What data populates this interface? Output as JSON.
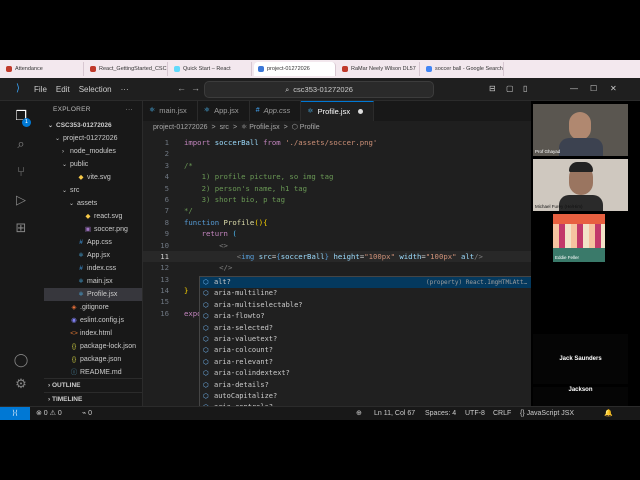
{
  "browser_tabs": [
    {
      "label": "Attendance",
      "color": "#c0392b",
      "active": false
    },
    {
      "label": "React_GettingStarted_CSC",
      "color": "#c0392b",
      "active": false
    },
    {
      "label": "Quick Start – React",
      "color": "#61dafb",
      "active": false
    },
    {
      "label": "project-01272026",
      "color": "#3c78d8",
      "active": true
    },
    {
      "label": "RaMar Neely Wilson DL57",
      "color": "#c0392b",
      "active": false
    },
    {
      "label": "soccer ball - Google Search",
      "color": "#4285f4",
      "active": false
    }
  ],
  "titlebar": {
    "menus": [
      "File",
      "Edit",
      "Selection",
      "···"
    ],
    "search_text": "csc353-01272026",
    "window_controls": [
      "⊟",
      "▢",
      "▯",
      "—",
      "☐",
      "✕"
    ]
  },
  "explorer": {
    "header": "EXPLORER",
    "dots": "···",
    "items": [
      {
        "label": "CSC353-01272026",
        "depth": 0,
        "twisty": "⌄",
        "icon": "",
        "bold": true,
        "selected": false
      },
      {
        "label": "project-01272026",
        "depth": 1,
        "twisty": "⌄",
        "icon": "",
        "bold": false,
        "selected": false
      },
      {
        "label": "node_modules",
        "depth": 2,
        "twisty": "›",
        "icon": "",
        "bold": false,
        "selected": false
      },
      {
        "label": "public",
        "depth": 2,
        "twisty": "⌄",
        "icon": "",
        "bold": false,
        "selected": false
      },
      {
        "label": "vite.svg",
        "depth": 3,
        "twisty": "",
        "icon": "◆",
        "iconColor": "#f7c948",
        "bold": false,
        "selected": false
      },
      {
        "label": "src",
        "depth": 2,
        "twisty": "⌄",
        "icon": "",
        "bold": false,
        "selected": false
      },
      {
        "label": "assets",
        "depth": 3,
        "twisty": "⌄",
        "icon": "",
        "bold": false,
        "selected": false
      },
      {
        "label": "react.svg",
        "depth": 4,
        "twisty": "",
        "icon": "◆",
        "iconColor": "#f7c948",
        "bold": false,
        "selected": false
      },
      {
        "label": "soccer.png",
        "depth": 4,
        "twisty": "",
        "icon": "▣",
        "iconColor": "#a074c4",
        "bold": false,
        "selected": false
      },
      {
        "label": "App.css",
        "depth": 3,
        "twisty": "",
        "icon": "#",
        "iconColor": "#42a5f5",
        "bold": false,
        "selected": false
      },
      {
        "label": "App.jsx",
        "depth": 3,
        "twisty": "",
        "icon": "⚛",
        "iconColor": "#4fc1ff",
        "bold": false,
        "selected": false
      },
      {
        "label": "index.css",
        "depth": 3,
        "twisty": "",
        "icon": "#",
        "iconColor": "#42a5f5",
        "bold": false,
        "selected": false
      },
      {
        "label": "main.jsx",
        "depth": 3,
        "twisty": "",
        "icon": "⚛",
        "iconColor": "#4fc1ff",
        "bold": false,
        "selected": false
      },
      {
        "label": "Profile.jsx",
        "depth": 3,
        "twisty": "",
        "icon": "⚛",
        "iconColor": "#4fc1ff",
        "bold": false,
        "selected": true
      },
      {
        "label": ".gitignore",
        "depth": 2,
        "twisty": "",
        "icon": "◈",
        "iconColor": "#e8703a",
        "bold": false,
        "selected": false
      },
      {
        "label": "eslint.config.js",
        "depth": 2,
        "twisty": "",
        "icon": "◉",
        "iconColor": "#8080f2",
        "bold": false,
        "selected": false
      },
      {
        "label": "index.html",
        "depth": 2,
        "twisty": "",
        "icon": "<>",
        "iconColor": "#e37933",
        "bold": false,
        "selected": false
      },
      {
        "label": "package-lock.json",
        "depth": 2,
        "twisty": "",
        "icon": "{}",
        "iconColor": "#cbcb41",
        "bold": false,
        "selected": false
      },
      {
        "label": "package.json",
        "depth": 2,
        "twisty": "",
        "icon": "{}",
        "iconColor": "#cbcb41",
        "bold": false,
        "selected": false
      },
      {
        "label": "README.md",
        "depth": 2,
        "twisty": "",
        "icon": "ⓘ",
        "iconColor": "#519aba",
        "bold": false,
        "selected": false
      }
    ],
    "outline_label": "OUTLINE",
    "timeline_label": "TIMELINE"
  },
  "activity": {
    "badge": "1"
  },
  "editor_tabs": [
    {
      "label": "main.jsx",
      "italic": false,
      "active": false,
      "dirty": false
    },
    {
      "label": "App.jsx",
      "italic": false,
      "active": false,
      "dirty": false
    },
    {
      "label": "App.css",
      "italic": true,
      "active": false,
      "dirty": false
    },
    {
      "label": "Profile.jsx",
      "italic": false,
      "active": true,
      "dirty": true
    }
  ],
  "breadcrumb": [
    "project-01272026",
    ">",
    "src",
    ">",
    "⚛ Profile.jsx",
    ">",
    "⬡ Profile"
  ],
  "code_lines": [
    {
      "n": "1",
      "tokens": [
        [
          "k2",
          "import "
        ],
        [
          "v",
          "soccerBall"
        ],
        [
          "k2",
          " from "
        ],
        [
          "s",
          "'./assets/soccer.png'"
        ]
      ]
    },
    {
      "n": "2",
      "tokens": []
    },
    {
      "n": "3",
      "tokens": [
        [
          "c",
          "/*"
        ]
      ]
    },
    {
      "n": "4",
      "tokens": [
        [
          "c",
          "    1) profile picture, so img tag"
        ]
      ]
    },
    {
      "n": "5",
      "tokens": [
        [
          "c",
          "    2) person's name, h1 tag"
        ]
      ]
    },
    {
      "n": "6",
      "tokens": [
        [
          "c",
          "    3) short bio, p tag"
        ]
      ]
    },
    {
      "n": "7",
      "tokens": [
        [
          "c",
          "*/"
        ]
      ]
    },
    {
      "n": "8",
      "tokens": [
        [
          "k",
          "function "
        ],
        [
          "f",
          "Profile"
        ],
        [
          "y",
          "()"
        ],
        [
          "y",
          "{"
        ]
      ]
    },
    {
      "n": "9",
      "tokens": [
        [
          "d",
          "    "
        ],
        [
          "k2",
          "return "
        ],
        [
          "j",
          "("
        ]
      ]
    },
    {
      "n": "10",
      "tokens": [
        [
          "d",
          "        "
        ],
        [
          "g",
          "<>"
        ]
      ]
    },
    {
      "n": "11",
      "tokens": [
        [
          "d",
          "            "
        ],
        [
          "g",
          "<"
        ],
        [
          "k",
          "img "
        ],
        [
          "v",
          "src"
        ],
        [
          "d",
          "="
        ],
        [
          "k",
          "{"
        ],
        [
          "v",
          "soccerBall"
        ],
        [
          "k",
          "}"
        ],
        [
          "d",
          " "
        ],
        [
          "v",
          "height"
        ],
        [
          "d",
          "="
        ],
        [
          "s",
          "\"100px\""
        ],
        [
          "d",
          " "
        ],
        [
          "v",
          "width"
        ],
        [
          "d",
          "="
        ],
        [
          "s",
          "\"100px\""
        ],
        [
          "d",
          " "
        ],
        [
          "v",
          "alt"
        ],
        [
          "g",
          "/>"
        ]
      ]
    },
    {
      "n": "12",
      "tokens": [
        [
          "d",
          "        "
        ],
        [
          "g",
          "</>"
        ]
      ]
    },
    {
      "n": "13",
      "tokens": [
        [
          "d",
          "    "
        ],
        [
          "j",
          ")"
        ]
      ]
    },
    {
      "n": "14",
      "tokens": [
        [
          "y",
          "}"
        ]
      ]
    },
    {
      "n": "15",
      "tokens": []
    },
    {
      "n": "16",
      "tokens": [
        [
          "k2",
          "export default "
        ],
        [
          "v",
          "Profile"
        ]
      ]
    }
  ],
  "current_line": "11",
  "suggestions": [
    {
      "label": "alt?",
      "detail": "(property) React.ImgHTMLAtt…",
      "selected": true
    },
    {
      "label": "aria-multiline?",
      "detail": "",
      "selected": false
    },
    {
      "label": "aria-multiselectable?",
      "detail": "",
      "selected": false
    },
    {
      "label": "aria-flowto?",
      "detail": "",
      "selected": false
    },
    {
      "label": "aria-selected?",
      "detail": "",
      "selected": false
    },
    {
      "label": "aria-valuetext?",
      "detail": "",
      "selected": false
    },
    {
      "label": "aria-colcount?",
      "detail": "",
      "selected": false
    },
    {
      "label": "aria-relevant?",
      "detail": "",
      "selected": false
    },
    {
      "label": "aria-colindextext?",
      "detail": "",
      "selected": false
    },
    {
      "label": "aria-details?",
      "detail": "",
      "selected": false
    },
    {
      "label": "autoCapitalize?",
      "detail": "",
      "selected": false
    },
    {
      "label": "aria-controls?",
      "detail": "",
      "selected": false
    }
  ],
  "participants": [
    {
      "name": "Prof Ghayad",
      "type": "video"
    },
    {
      "name": "Michael Furey (He/Him)",
      "type": "video"
    },
    {
      "name": "Eddie Feller",
      "type": "video"
    },
    {
      "name": "Jack Saunders",
      "type": "name"
    },
    {
      "name": "Jackson",
      "type": "name"
    }
  ],
  "statusbar": {
    "remote": "⟩⟨",
    "problems": "⊗ 0 ⚠ 0",
    "ports": "⌁ 0",
    "zoom_icon": "⊕",
    "position": "Ln 11, Col 67",
    "spaces": "Spaces: 4",
    "encoding": "UTF-8",
    "eol": "CRLF",
    "language": "{} JavaScript JSX",
    "bell": "🔔"
  }
}
